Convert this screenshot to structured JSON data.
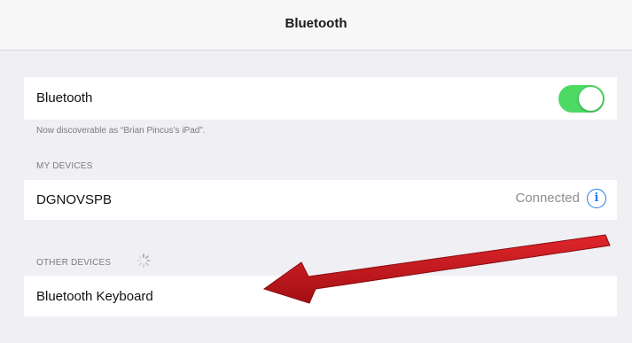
{
  "navbar": {
    "title": "Bluetooth"
  },
  "bluetooth_cell": {
    "label": "Bluetooth",
    "toggle_on": true,
    "toggle_color": "#4cd964"
  },
  "discoverable_text": "Now discoverable as “Brian Pincus’s iPad”.",
  "my_devices": {
    "header": "MY DEVICES",
    "items": [
      {
        "name": "DGNOVSPB",
        "status": "Connected",
        "info_icon": "info-circle-icon"
      }
    ]
  },
  "other_devices": {
    "header": "OTHER DEVICES",
    "items": [
      {
        "name": "Bluetooth Keyboard"
      }
    ]
  },
  "accent_color": "#1f7cf0",
  "annotation": {
    "arrow_color": "#c8141a"
  }
}
